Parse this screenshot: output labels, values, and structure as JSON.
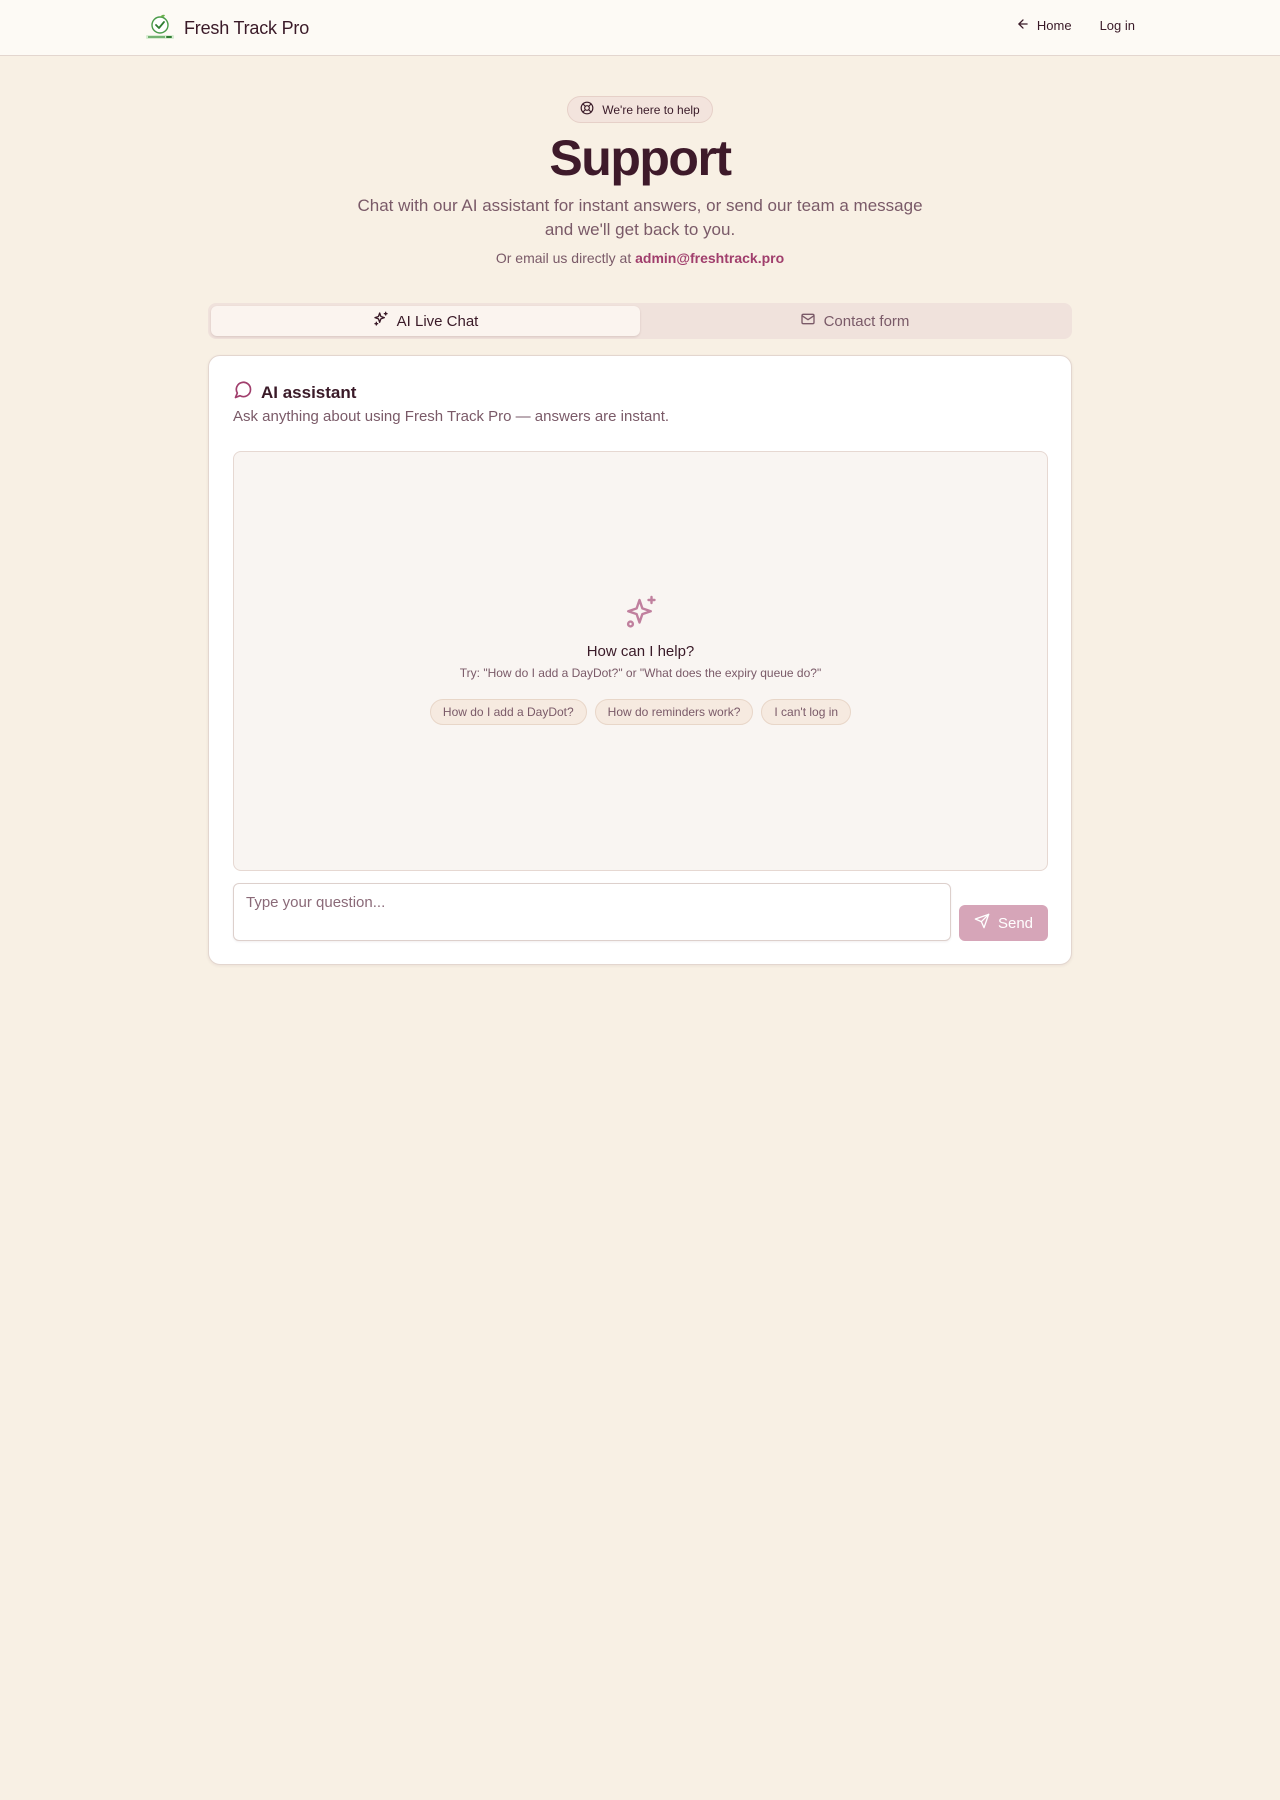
{
  "header": {
    "brand": "Fresh Track Pro",
    "nav": {
      "home": "Home",
      "login": "Log in"
    }
  },
  "hero": {
    "badge": "We're here to help",
    "title": "Support",
    "subtitle": "Chat with our AI assistant for instant answers, or send our team a message and we'll get back to you.",
    "email_prefix": "Or email us directly at ",
    "email": "admin@freshtrack.pro"
  },
  "tabs": [
    {
      "label": "AI Live Chat",
      "active": true
    },
    {
      "label": "Contact form",
      "active": false
    }
  ],
  "assistant": {
    "title": "AI assistant",
    "description": "Ask anything about using Fresh Track Pro — answers are instant.",
    "empty_title": "How can I help?",
    "empty_hint": "Try: \"How do I add a DayDot?\" or \"What does the expiry queue do?\"",
    "suggestions": [
      "How do I add a DayDot?",
      "How do reminders work?",
      "I can't log in"
    ],
    "input_placeholder": "Type your question...",
    "send_label": "Send"
  },
  "colors": {
    "background": "#f8f0e4",
    "accent": "#a03e6c",
    "send_button": "#d6a5b8",
    "heading": "#3e1a2a"
  },
  "icons": {
    "logo": "fresh-track-pro-logo",
    "home": "arrow-left-icon",
    "badge": "life-buoy-icon",
    "chat_tab": "sparkles-icon",
    "contact_tab": "mail-icon",
    "assistant": "message-circle-icon",
    "empty": "sparkles-icon",
    "send": "send-icon"
  }
}
